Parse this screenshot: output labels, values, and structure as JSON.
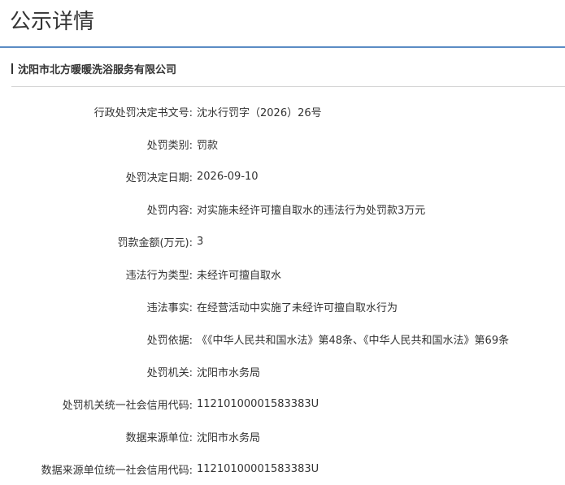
{
  "page": {
    "title": "公示详情"
  },
  "company": {
    "name": "沈阳市北方暖暖洗浴服务有限公司"
  },
  "details": [
    {
      "label": "行政处罚决定书文号:",
      "value": "沈水行罚字（2026）26号"
    },
    {
      "label": "处罚类别:",
      "value": "罚款"
    },
    {
      "label": "处罚决定日期:",
      "value": "2026-09-10"
    },
    {
      "label": "处罚内容:",
      "value": "对实施未经许可擅自取水的违法行为处罚款3万元"
    },
    {
      "label": "罚款金额(万元):",
      "value": "3"
    },
    {
      "label": "违法行为类型:",
      "value": "未经许可擅自取水"
    },
    {
      "label": "违法事实:",
      "value": "在经营活动中实施了未经许可擅自取水行为"
    },
    {
      "label": "处罚依据:",
      "value": "《《中华人民共和国水法》第48条、《中华人民共和国水法》第69条"
    },
    {
      "label": "处罚机关:",
      "value": "沈阳市水务局"
    },
    {
      "label": "处罚机关统一社会信用代码:",
      "value": "11210100001583383U"
    },
    {
      "label": "数据来源单位:",
      "value": "沈阳市水务局"
    },
    {
      "label": "数据来源单位统一社会信用代码:",
      "value": "11210100001583383U"
    }
  ]
}
